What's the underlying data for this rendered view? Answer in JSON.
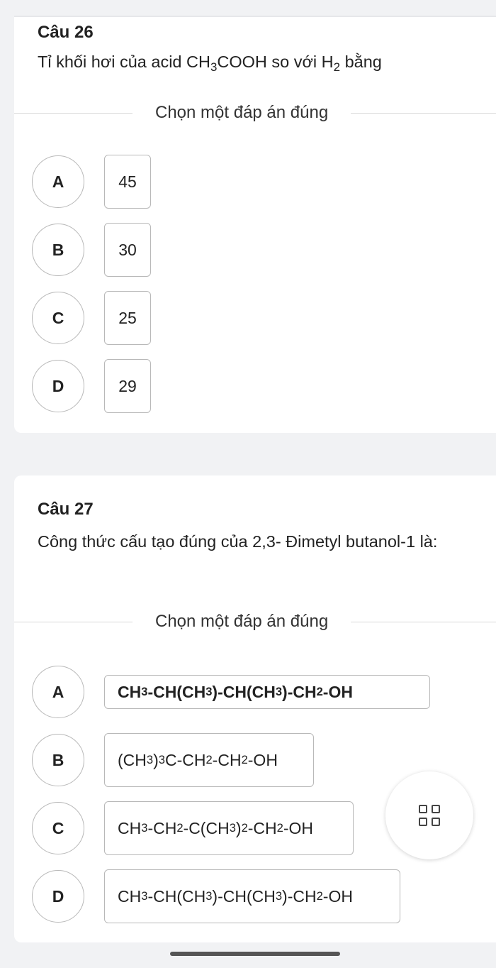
{
  "q26": {
    "title": "Câu 26",
    "text_pre": "Tỉ khối hơi của acid CH",
    "text_sub1": "3",
    "text_mid": "COOH so với H",
    "text_sub2": "2",
    "text_post": " bằng",
    "choose": "Chọn một đáp án đúng",
    "options": [
      {
        "letter": "A",
        "value": "45"
      },
      {
        "letter": "B",
        "value": "30"
      },
      {
        "letter": "C",
        "value": "25"
      },
      {
        "letter": "D",
        "value": "29"
      }
    ]
  },
  "q27": {
    "title": "Câu 27",
    "text": "Công thức cấu tạo đúng của 2,3- Đimetyl butanol-1 là:",
    "choose": "Chọn một đáp án đúng",
    "options": [
      {
        "letter": "A",
        "formula": "CH3-CH(CH3)-CH(CH3)-CH2-OH"
      },
      {
        "letter": "B",
        "formula": "(CH3)3C-CH2-CH2-OH"
      },
      {
        "letter": "C",
        "formula": "CH3-CH2-C(CH3)2-CH2-OH"
      },
      {
        "letter": "D",
        "formula": "CH3-CH(CH3)-CH(CH3)-CH2-OH"
      }
    ]
  },
  "fab": {
    "icon": "grid-icon"
  }
}
